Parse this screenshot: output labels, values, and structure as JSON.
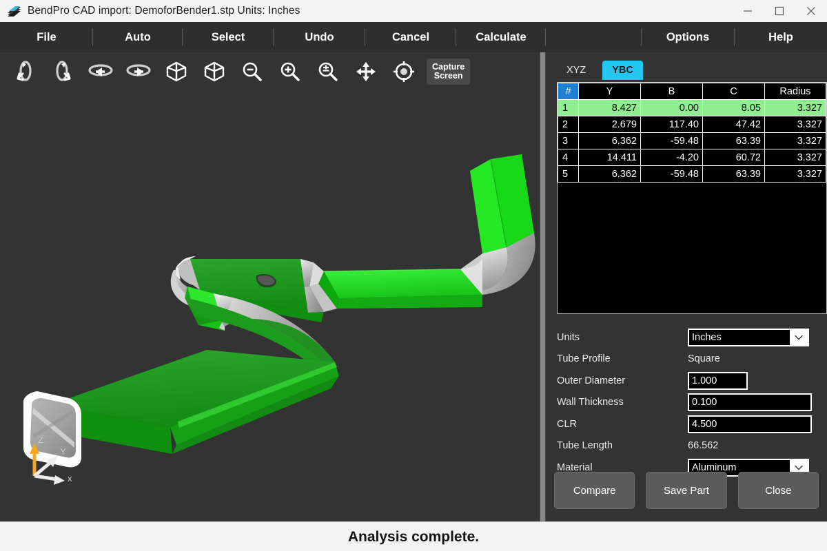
{
  "window": {
    "title": "BendPro CAD import: DemoforBender1.stp  Units: Inches",
    "icon": "bent-tube-logo-icon",
    "minimize": "–",
    "maximize": "□",
    "close": "×"
  },
  "menu": {
    "left": [
      {
        "label": "File",
        "name": "menu-file"
      },
      {
        "label": "Auto",
        "name": "menu-auto"
      },
      {
        "label": "Select",
        "name": "menu-select"
      },
      {
        "label": "Undo",
        "name": "menu-undo"
      },
      {
        "label": "Cancel",
        "name": "menu-cancel"
      },
      {
        "label": "Calculate",
        "name": "menu-calculate"
      }
    ],
    "right": [
      {
        "label": "Options",
        "name": "menu-options"
      },
      {
        "label": "Help",
        "name": "menu-help"
      }
    ]
  },
  "viewport_toolbar": {
    "tools": [
      {
        "name": "rotate-vertical-ccw-icon",
        "title": "Rotate vertical CCW"
      },
      {
        "name": "rotate-vertical-cw-icon",
        "title": "Rotate vertical CW"
      },
      {
        "name": "rotate-horizontal-left-icon",
        "title": "Rotate horizontal left"
      },
      {
        "name": "rotate-horizontal-right-icon",
        "title": "Rotate horizontal right"
      },
      {
        "name": "view-cube-1-icon",
        "title": "Isometric view 1"
      },
      {
        "name": "view-cube-2-icon",
        "title": "Isometric view 2"
      },
      {
        "name": "zoom-out-icon",
        "title": "Zoom out"
      },
      {
        "name": "zoom-in-icon",
        "title": "Zoom in"
      },
      {
        "name": "zoom-fit-icon",
        "title": "Zoom to fit"
      },
      {
        "name": "pan-icon",
        "title": "Pan"
      },
      {
        "name": "center-target-icon",
        "title": "Center view"
      }
    ],
    "capture_line1": "Capture",
    "capture_line2": "Screen"
  },
  "gizmo": {
    "z_label": "Z",
    "y_label": "Y",
    "x_label": "x",
    "z_color": "#f5a623",
    "axis_color": "#e8e8e8"
  },
  "tabs": [
    {
      "label": "XYZ",
      "name": "tab-xyz",
      "active": false
    },
    {
      "label": "YBC",
      "name": "tab-ybc",
      "active": true
    }
  ],
  "table": {
    "columns": [
      "#",
      "Y",
      "B",
      "C",
      "Radius"
    ],
    "selected_row": 1,
    "rows": [
      {
        "n": "1",
        "Y": "8.427",
        "B": "0.00",
        "C": "8.05",
        "Radius": "3.327"
      },
      {
        "n": "2",
        "Y": "2.679",
        "B": "117.40",
        "C": "47.42",
        "Radius": "3.327"
      },
      {
        "n": "3",
        "Y": "6.362",
        "B": "-59.48",
        "C": "63.39",
        "Radius": "3.327"
      },
      {
        "n": "4",
        "Y": "14.411",
        "B": "-4.20",
        "C": "60.72",
        "Radius": "3.327"
      },
      {
        "n": "5",
        "Y": "6.362",
        "B": "-59.48",
        "C": "63.39",
        "Radius": "3.327"
      }
    ]
  },
  "form": {
    "units_label": "Units",
    "units_value": "Inches",
    "tube_profile_label": "Tube Profile",
    "tube_profile_value": "Square",
    "outer_diameter_label": "Outer Diameter",
    "outer_diameter_value": "1.000",
    "wall_thickness_label": "Wall Thickness",
    "wall_thickness_value": "0.100",
    "clr_label": "CLR",
    "clr_value": "4.500",
    "tube_length_label": "Tube Length",
    "tube_length_value": "66.562",
    "material_label": "Material",
    "material_value": "Aluminum"
  },
  "buttons": {
    "compare": "Compare",
    "save_part": "Save Part",
    "close": "Close"
  },
  "status": {
    "message": "Analysis complete."
  },
  "colors": {
    "accent_tab": "#22c8f0",
    "index_header": "#1e7fd4",
    "selected_row": "#90ee90",
    "tube_green_light": "#22dd22",
    "tube_green_dark": "#1a9a1a",
    "tube_gray": "#b8b8b8",
    "panel_bg": "#333333",
    "menu_bg": "#2e2e2e",
    "titlebar_bg": "#f3f3f3"
  }
}
